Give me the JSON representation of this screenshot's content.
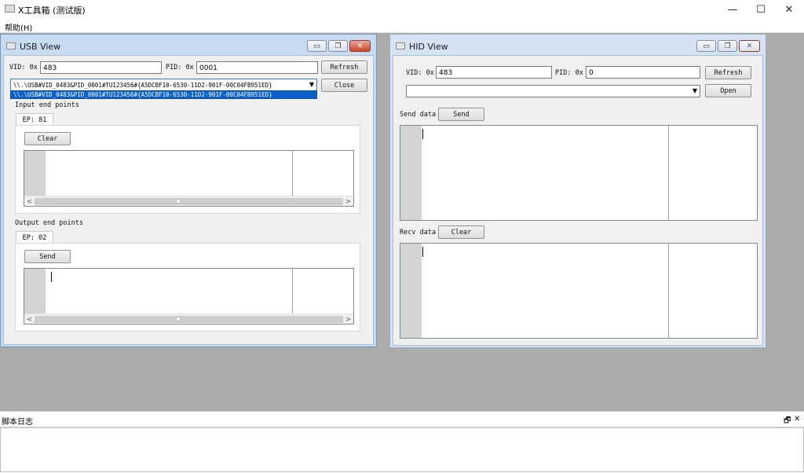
{
  "app": {
    "title": "X工具箱 (测试版)",
    "controls": {
      "minimize": "—",
      "maximize": "☐",
      "close": "✕"
    }
  },
  "menu": {
    "help": "帮助(H)"
  },
  "usb_view": {
    "title": "USB View",
    "window_controls": {
      "minimize": "▭",
      "restore": "❐",
      "close": "✕"
    },
    "vid_label": "VID: 0x",
    "vid_value": "483",
    "pid_label": "PID: 0x",
    "pid_value": "0001",
    "refresh_label": "Refresh",
    "close_label": "Close",
    "device_selected": "\\\\.\\USB#VID_0483&PID_0001#TU123456#{A5DCBF10-6530-11D2-901F-00C04FB951ED}",
    "device_options": [
      "\\\\.\\USB#VID_0483&PID_0001#TU123456#{A5DCBF10-6530-11D2-901F-00C04FB951ED}"
    ],
    "input_section": "Input end points",
    "input_tab": "EP: 81",
    "clear_label": "Clear",
    "output_section": "Output end points",
    "output_tab": "EP: 02",
    "send_label": "Send",
    "scroll_left": "<",
    "scroll_right": ">"
  },
  "hid_view": {
    "title": "HID View",
    "window_controls": {
      "minimize": "▭",
      "restore": "❐",
      "close": "✕"
    },
    "vid_label": "VID: 0x",
    "vid_value": "483",
    "pid_label": "PID: 0x",
    "pid_value": "0",
    "refresh_label": "Refresh",
    "open_label": "Open",
    "device_selected": "",
    "send_data_label": "Send data",
    "send_label": "Send",
    "recv_data_label": "Recv data",
    "clear_label": "Clear"
  },
  "log_panel": {
    "title": "脚本日志",
    "float_icon": "🗗",
    "close_icon": "✕"
  },
  "icons": [
    "app-icon",
    "window-icon",
    "dropdown-arrow-icon",
    "scroll-left-icon",
    "scroll-right-icon"
  ]
}
